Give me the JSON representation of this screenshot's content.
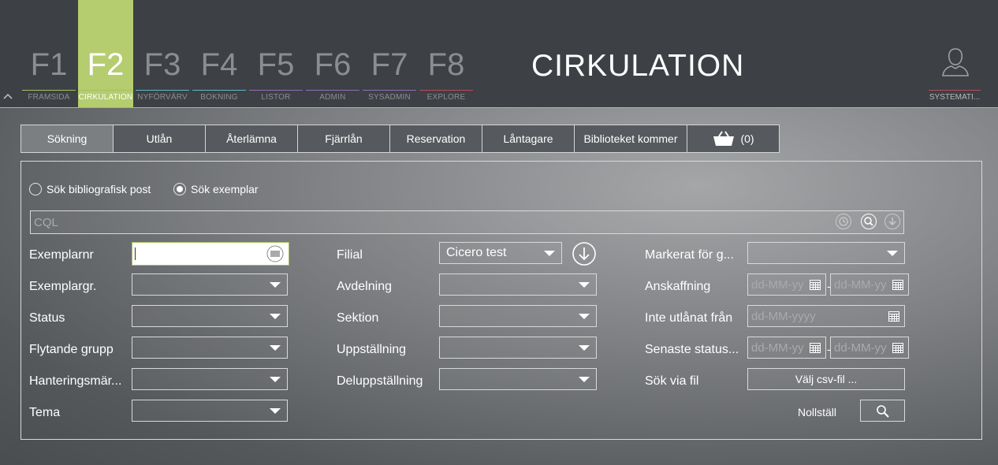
{
  "fkeys": [
    {
      "key": "F1",
      "label": "FRAMSIDA",
      "color": "#a6bf63",
      "active": false
    },
    {
      "key": "F2",
      "label": "CIRKULATION",
      "color": "#a6bf63",
      "active": true
    },
    {
      "key": "F3",
      "label": "NYFÖRVÄRV",
      "color": "#5fb8c9",
      "active": false
    },
    {
      "key": "F4",
      "label": "BOKNING",
      "color": "#5fb8c9",
      "active": false
    },
    {
      "key": "F5",
      "label": "LISTOR",
      "color": "#8c6fb6",
      "active": false
    },
    {
      "key": "F6",
      "label": "ADMIN",
      "color": "#8c6fb6",
      "active": false
    },
    {
      "key": "F7",
      "label": "SYSADMIN",
      "color": "#8c6fb6",
      "active": false
    },
    {
      "key": "F8",
      "label": "EXPLORE",
      "color": "#b84a5e",
      "active": false
    }
  ],
  "header": {
    "title": "CIRKULATION",
    "user_label": "SYSTEMATI..."
  },
  "tabs": [
    "Sökning",
    "Utlån",
    "Återlämna",
    "Fjärrlån",
    "Reservation",
    "Låntagare",
    "Biblioteket kommer"
  ],
  "basket": {
    "count": "(0)"
  },
  "search": {
    "radio_biblio": "Sök bibliografisk post",
    "radio_exemplar": "Sök exemplar",
    "cql_placeholder": "CQL"
  },
  "col1": {
    "exemplarnr": "Exemplarnr",
    "exemplargr": "Exemplargr.",
    "status": "Status",
    "flytande": "Flytande grupp",
    "hantering": "Hanteringsmär...",
    "tema": "Tema"
  },
  "col2": {
    "filial": "Filial",
    "filial_value": "Cicero test",
    "avdelning": "Avdelning",
    "sektion": "Sektion",
    "uppstallning": "Uppställning",
    "deluppstallning": "Deluppställning"
  },
  "col3": {
    "markerat": "Markerat för g...",
    "anskaffning": "Anskaffning",
    "inte_utlanat": "Inte utlånat från",
    "senaste_status": "Senaste status...",
    "sok_via_fil": "Sök via fil",
    "date_placeholder_short": "dd-MM-yy",
    "date_placeholder_full": "dd-MM-yyyy",
    "csv_button": "Välj csv-fil ...",
    "reset": "Nollställ"
  }
}
